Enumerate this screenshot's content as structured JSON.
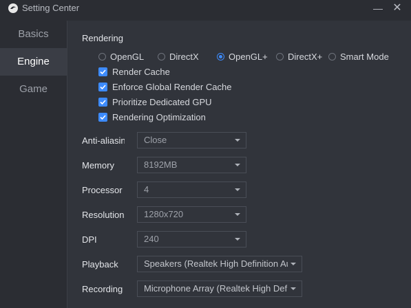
{
  "window": {
    "title": "Setting Center",
    "minimize": "—",
    "close": "✕"
  },
  "sidebar": {
    "items": [
      {
        "label": "Basics",
        "active": false
      },
      {
        "label": "Engine",
        "active": true
      },
      {
        "label": "Game",
        "active": false
      }
    ]
  },
  "rendering": {
    "title": "Rendering",
    "modes": [
      "OpenGL",
      "DirectX",
      "OpenGL+",
      "DirectX+",
      "Smart Mode"
    ],
    "selected_mode": "OpenGL+",
    "checkboxes": [
      {
        "label": "Render Cache",
        "checked": true
      },
      {
        "label": "Enforce Global Render Cache",
        "checked": true
      },
      {
        "label": "Prioritize Dedicated GPU",
        "checked": true
      },
      {
        "label": "Rendering Optimization",
        "checked": true
      }
    ]
  },
  "fields": {
    "antialiasing": {
      "label": "Anti-aliasing",
      "value": "Close"
    },
    "memory": {
      "label": "Memory",
      "value": "8192MB"
    },
    "processor": {
      "label": "Processor",
      "value": "4"
    },
    "resolution": {
      "label": "Resolution",
      "value": "1280x720"
    },
    "dpi": {
      "label": "DPI",
      "value": "240"
    },
    "playback": {
      "label": "Playback",
      "value": "Speakers (Realtek High Definition Audio)"
    },
    "recording": {
      "label": "Recording",
      "value": "Microphone Array (Realtek High Definition Audio)"
    }
  },
  "colors": {
    "accent": "#3d8bfd",
    "background": "#31343b",
    "sidebar": "#2b2d33"
  }
}
